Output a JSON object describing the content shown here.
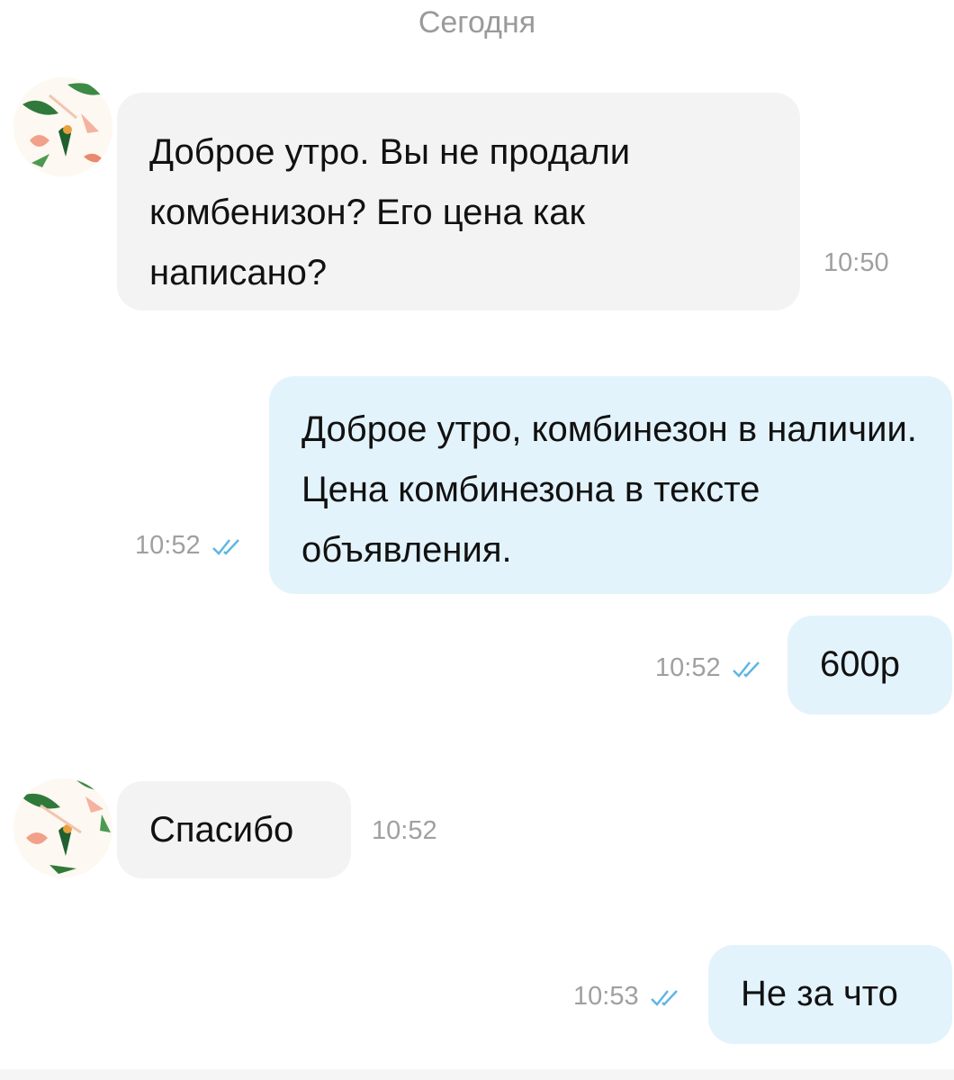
{
  "date_separator": "Сегодня",
  "colors": {
    "incoming_bubble": "#f3f3f3",
    "outgoing_bubble": "#e3f3fc",
    "read_check": "#5fb6e4",
    "timestamp": "#a0a0a0"
  },
  "messages": [
    {
      "direction": "incoming",
      "text": "Доброе утро. Вы не продали комбенизон? Его цена как написано?",
      "time": "10:50",
      "avatar_icon": "tropical-avatar-icon"
    },
    {
      "direction": "outgoing",
      "text": "Доброе утро, комбинезон в наличии. Цена комбинезона в тексте объявления.",
      "time": "10:52",
      "status_icon": "double-check-read-icon"
    },
    {
      "direction": "outgoing",
      "text": "600р",
      "time": "10:52",
      "status_icon": "double-check-read-icon"
    },
    {
      "direction": "incoming",
      "text": "Спасибо",
      "time": "10:52",
      "avatar_icon": "tropical-avatar-icon"
    },
    {
      "direction": "outgoing",
      "text": "Не за что",
      "time": "10:53",
      "status_icon": "double-check-read-icon"
    }
  ]
}
